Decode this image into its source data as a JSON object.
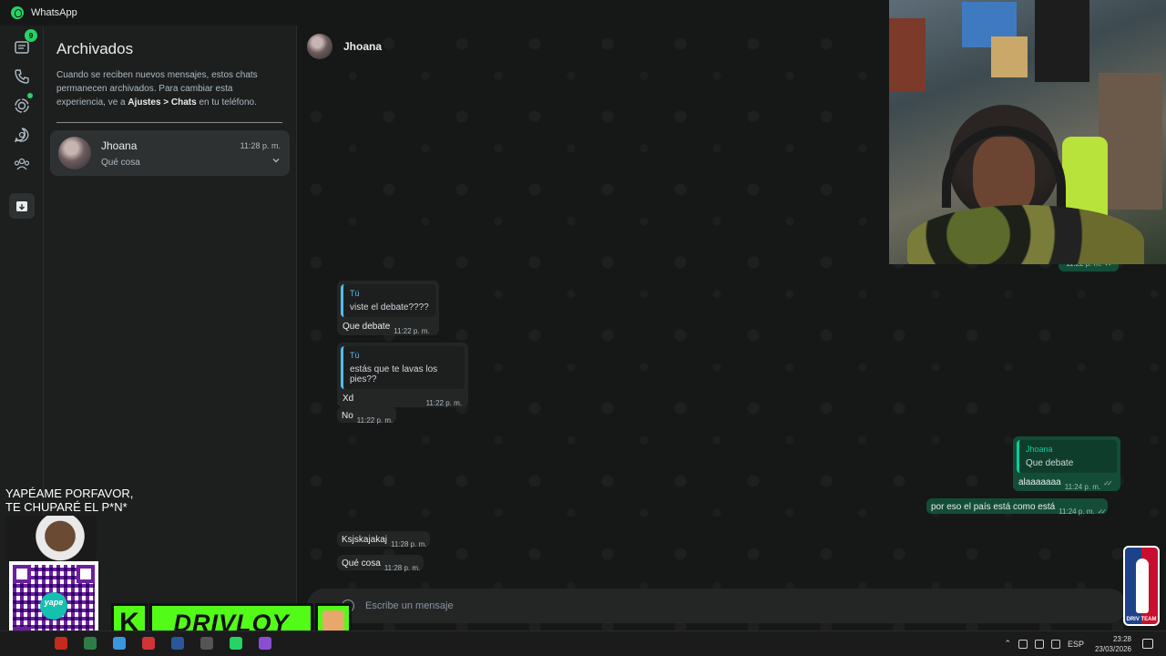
{
  "app": {
    "title": "WhatsApp"
  },
  "nav": {
    "chats_badge": "9"
  },
  "archived": {
    "title": "Archivados",
    "desc_1": "Cuando se reciben nuevos mensajes, estos chats permanecen archivados. Para cambiar esta experiencia, ve a ",
    "desc_bold": "Ajustes > Chats",
    "desc_2": " en tu teléfono.",
    "chat": {
      "name": "Jhoana",
      "time": "11:28 p. m.",
      "last": "Qué cosa"
    }
  },
  "conversation": {
    "contact": "Jhoana",
    "top_partial_time": "11:22 p. m.",
    "messages": [
      {
        "quote_author": "Tú",
        "quote_text": "viste el debate????",
        "text": "Que debate",
        "time": "11:22 p. m."
      },
      {
        "quote_author": "Tú",
        "quote_text": "estás que te lavas los pies??",
        "text": "Xd",
        "time": "11:22 p. m."
      },
      {
        "text": "No",
        "time": "11:22 p. m."
      },
      {
        "quote_author": "Jhoana",
        "quote_text": "Que debate",
        "text": "alaaaaaaa",
        "time": "11:24 p. m."
      },
      {
        "text": "por eso el país está como está",
        "time": "11:24 p. m."
      },
      {
        "text": "Ksjskajakaj",
        "time": "11:28 p. m."
      },
      {
        "text": "Qué cosa",
        "time": "11:28 p. m."
      }
    ],
    "composer_placeholder": "Escribe un mensaje"
  },
  "stream_overlay": {
    "donation_text_1": "YAPÉAME PORFAVOR,",
    "donation_text_2": "TE CHUPARÉ  EL P*N*",
    "qr_label": "yape",
    "kick_letter": "K",
    "kick_name": "DRIVLOY",
    "nba_label": "DRIV TEAM"
  },
  "taskbar": {
    "lang": "ESP",
    "time": "23:28",
    "date": "23/03/2026"
  }
}
